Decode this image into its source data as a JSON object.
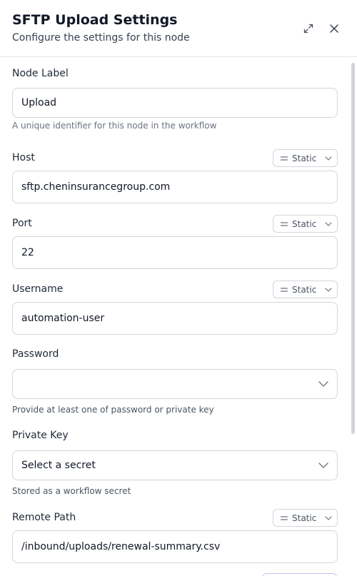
{
  "header": {
    "title": "SFTP Upload Settings",
    "subtitle": "Configure the settings for this node",
    "expand_icon": "expand-icon",
    "close_icon": "close-icon"
  },
  "fields": {
    "node_label": {
      "label": "Node Label",
      "value": "Upload",
      "hint": "A unique identifier for this node in the workflow"
    },
    "host": {
      "label": "Host",
      "value": "sftp.cheninsurancegroup.com",
      "mode": "Static"
    },
    "port": {
      "label": "Port",
      "value": "22",
      "mode": "Static"
    },
    "username": {
      "label": "Username",
      "value": "automation-user",
      "mode": "Static"
    },
    "password": {
      "label": "Password",
      "value": "",
      "hint": "Provide at least one of password or private key"
    },
    "private_key": {
      "label": "Private Key",
      "value": "Select a secret",
      "hint": "Stored as a workflow secret"
    },
    "remote_path": {
      "label": "Remote Path",
      "value": "/inbound/uploads/renewal-summary.csv",
      "mode": "Static"
    }
  },
  "colors": {
    "border": "#d1d5db",
    "text": "#111827",
    "muted": "#6b7280"
  }
}
